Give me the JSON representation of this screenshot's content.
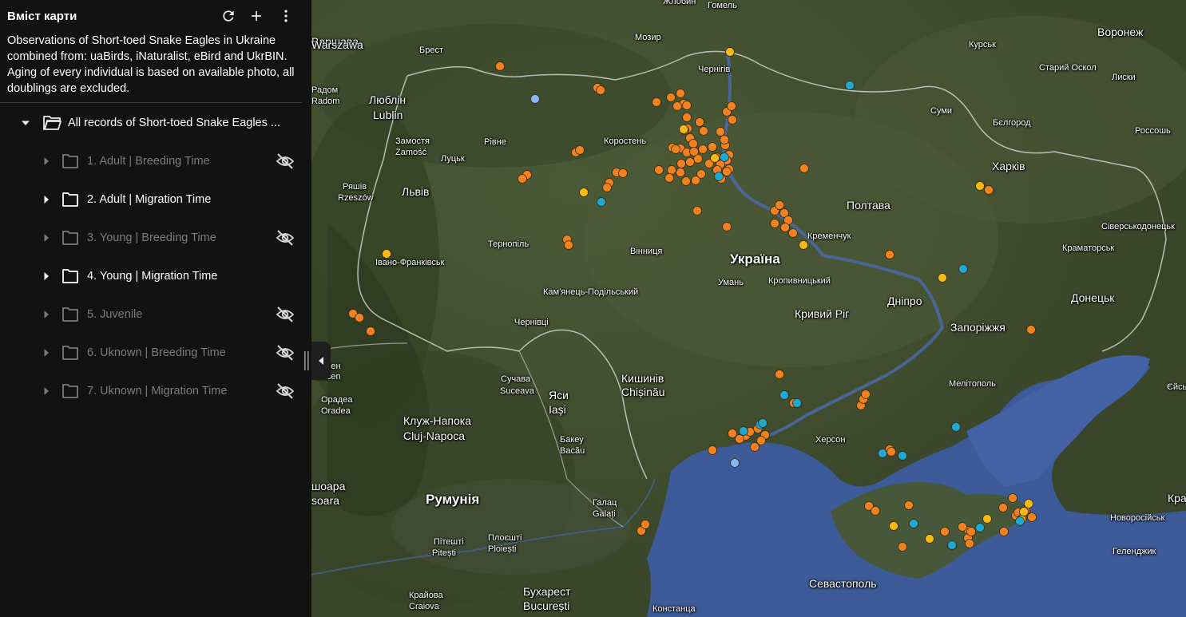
{
  "sidebar": {
    "title": "Вміст карти",
    "description": "Observations of Short-toed Snake Eagles in Ukraine combined from: uaBirds, iNaturalist, eBird and UkrBIN. Aging of every individual is based on available photo, all doublings are excluded.",
    "header_icons": [
      "refresh-icon",
      "plus-icon",
      "more-vert-icon"
    ],
    "root_folder": {
      "label": "All records of Short-toed Snake Eagles ...",
      "expanded": true
    },
    "layers": [
      {
        "label": "1. Adult | Breeding Time",
        "visible": false
      },
      {
        "label": "2. Adult | Migration Time",
        "visible": true
      },
      {
        "label": "3. Young | Breeding Time",
        "visible": false
      },
      {
        "label": "4. Young | Migration Time",
        "visible": true
      },
      {
        "label": "5. Juvenile",
        "visible": false
      },
      {
        "label": "6. Uknown | Breeding Time",
        "visible": false
      },
      {
        "label": "7. Uknown | Migration Time",
        "visible": false
      }
    ]
  },
  "map": {
    "colors": {
      "land": "#3f4d30",
      "sea": "#3c5a9a",
      "border": "#c8c8c8",
      "orange": "#f2821f",
      "yellow": "#f7b916",
      "cyan": "#1fa8d2",
      "lightblue": "#8ab4f8"
    },
    "labels": [
      {
        "text": "Варшава",
        "size": "m"
      },
      {
        "text": "Warszawa",
        "size": "m"
      },
      {
        "text": "Брест",
        "size": "s"
      },
      {
        "text": "Мозир",
        "size": "s"
      },
      {
        "text": "Гомель",
        "size": "s"
      },
      {
        "text": "Жлобин",
        "size": "s"
      },
      {
        "text": "Курськ",
        "size": "s"
      },
      {
        "text": "Воронеж",
        "size": "m"
      },
      {
        "text": "Чернігів",
        "size": "s"
      },
      {
        "text": "Старий Оскол",
        "size": "s"
      },
      {
        "text": "Лиски",
        "size": "s"
      },
      {
        "text": "Радом",
        "size": "s"
      },
      {
        "text": "Radom",
        "size": "s"
      },
      {
        "text": "Люблін",
        "size": "m"
      },
      {
        "text": "Lublin",
        "size": "m"
      },
      {
        "text": "Суми",
        "size": "s"
      },
      {
        "text": "Бєлгород",
        "size": "s"
      },
      {
        "text": "Россошь",
        "size": "s"
      },
      {
        "text": "Замостя",
        "size": "s"
      },
      {
        "text": "Zamość",
        "size": "s"
      },
      {
        "text": "Рівне",
        "size": "s"
      },
      {
        "text": "Луцьк",
        "size": "s"
      },
      {
        "text": "Коростень",
        "size": "s"
      },
      {
        "text": "Харків",
        "size": "m"
      },
      {
        "text": "Ряшів",
        "size": "s"
      },
      {
        "text": "Rzeszów",
        "size": "s"
      },
      {
        "text": "Львів",
        "size": "m"
      },
      {
        "text": "Полтава",
        "size": "m"
      },
      {
        "text": "Сіверськодонецьк",
        "size": "s"
      },
      {
        "text": "Кременчук",
        "size": "s"
      },
      {
        "text": "Краматорськ",
        "size": "s"
      },
      {
        "text": "Тернопіль",
        "size": "s"
      },
      {
        "text": "Вінниця",
        "size": "s"
      },
      {
        "text": "Україна",
        "size": "l"
      },
      {
        "text": "Івано-Франківськ",
        "size": "s"
      },
      {
        "text": "Умань",
        "size": "s"
      },
      {
        "text": "Кропивницький",
        "size": "s"
      },
      {
        "text": "Кам'янець-Подільський",
        "size": "s"
      },
      {
        "text": "Дніпро",
        "size": "m"
      },
      {
        "text": "Донецьк",
        "size": "m"
      },
      {
        "text": "Кривий Ріг",
        "size": "m"
      },
      {
        "text": "Чернівці",
        "size": "s"
      },
      {
        "text": "Запоріжжя",
        "size": "m"
      },
      {
        "text": "Кишинів",
        "size": "m"
      },
      {
        "text": "Chișinău",
        "size": "m"
      },
      {
        "text": "Сучава",
        "size": "s"
      },
      {
        "text": "Suceava",
        "size": "s"
      },
      {
        "text": "Яси",
        "size": "m"
      },
      {
        "text": "Iași",
        "size": "m"
      },
      {
        "text": "Мелітополь",
        "size": "s"
      },
      {
        "text": "Єйськ",
        "size": "s"
      },
      {
        "text": "Орадеа",
        "size": "s"
      },
      {
        "text": "Oradea",
        "size": "s"
      },
      {
        "text": "Клуж-Напока",
        "size": "m"
      },
      {
        "text": "Cluj-Napoca",
        "size": "m"
      },
      {
        "text": "Херсон",
        "size": "s"
      },
      {
        "text": "Бакеу",
        "size": "s"
      },
      {
        "text": "Bacău",
        "size": "s"
      },
      {
        "text": "Румунія",
        "size": "l"
      },
      {
        "text": "Галац",
        "size": "s"
      },
      {
        "text": "Galați",
        "size": "s"
      },
      {
        "text": "Новоросійськ",
        "size": "s"
      },
      {
        "text": "Плоєшті",
        "size": "s"
      },
      {
        "text": "Ploiești",
        "size": "s"
      },
      {
        "text": "Пітешті",
        "size": "s"
      },
      {
        "text": "Pitești",
        "size": "s"
      },
      {
        "text": "Геленджик",
        "size": "s"
      },
      {
        "text": "Севастополь",
        "size": "m"
      },
      {
        "text": "Крайова",
        "size": "s"
      },
      {
        "text": "Craiova",
        "size": "s"
      },
      {
        "text": "Бухарест",
        "size": "m"
      },
      {
        "text": "București",
        "size": "m"
      },
      {
        "text": "Констанца",
        "size": "s"
      },
      {
        "text": "oreceн",
        "size": "s"
      },
      {
        "text": "orecen",
        "size": "s"
      },
      {
        "text": "шоара",
        "size": "m"
      },
      {
        "text": "soara",
        "size": "m"
      },
      {
        "text": "Кра",
        "size": "m"
      }
    ],
    "markers": {
      "orange": 110,
      "yellow": 14,
      "cyan": 17,
      "lightblue": 2
    }
  }
}
